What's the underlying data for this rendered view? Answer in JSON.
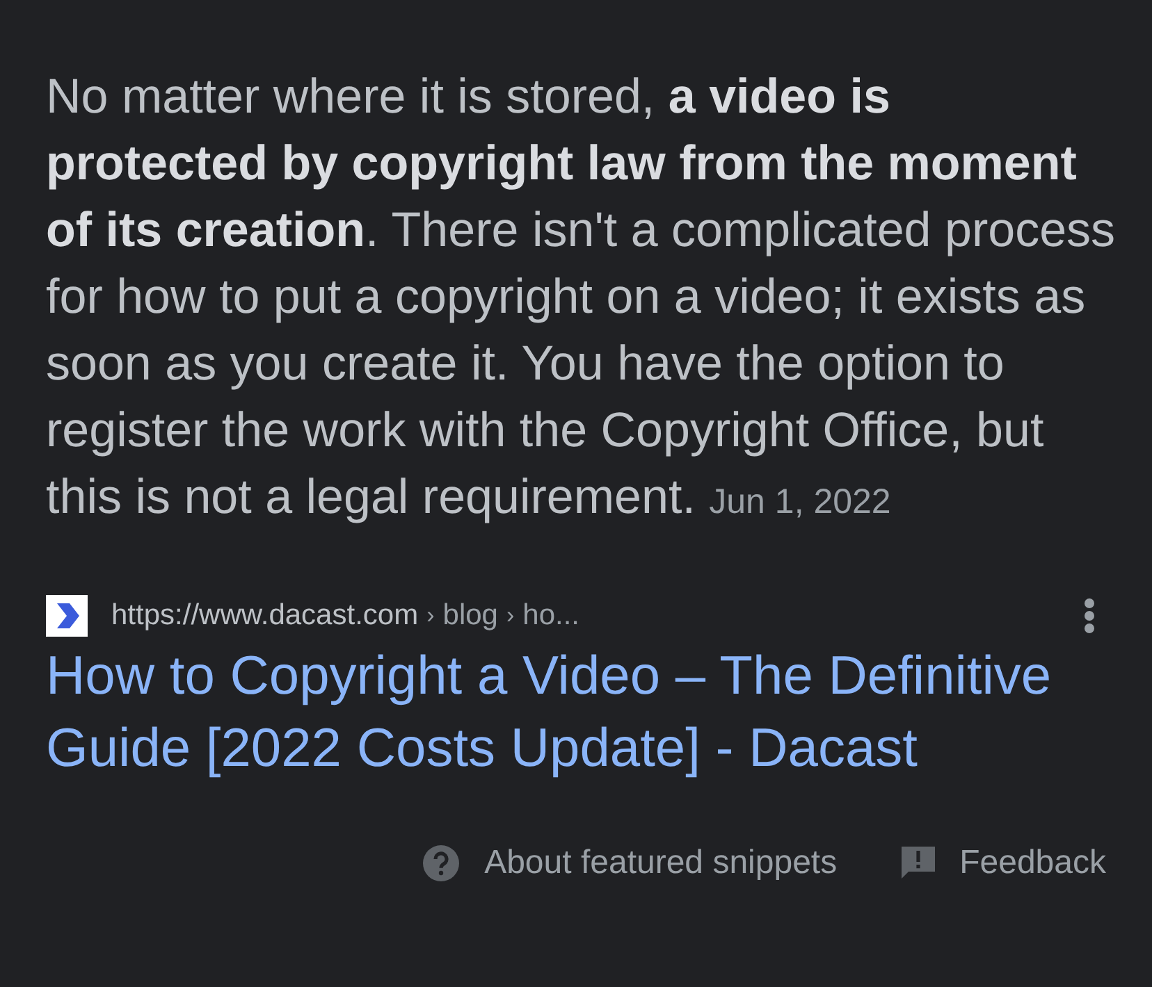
{
  "snippet": {
    "text": "No matter where it is stored, **a video is protected by copyright law from the moment of its creation**. There isn't a complicated process for how to put a copyright on a video; it exists as soon as you create it. You have the option to register the work with the Copyright Office, but this is not a legal requirement.",
    "date": "Jun 1, 2022"
  },
  "source": {
    "url": "https://www.dacast.com",
    "breadcrumbs": [
      "blog",
      "ho..."
    ],
    "separator": "›",
    "title": "How to Copyright a Video – The Definitive Guide [2022 Costs Update] - Dacast"
  },
  "footer": {
    "about": "About featured snippets",
    "feedback": "Feedback"
  }
}
